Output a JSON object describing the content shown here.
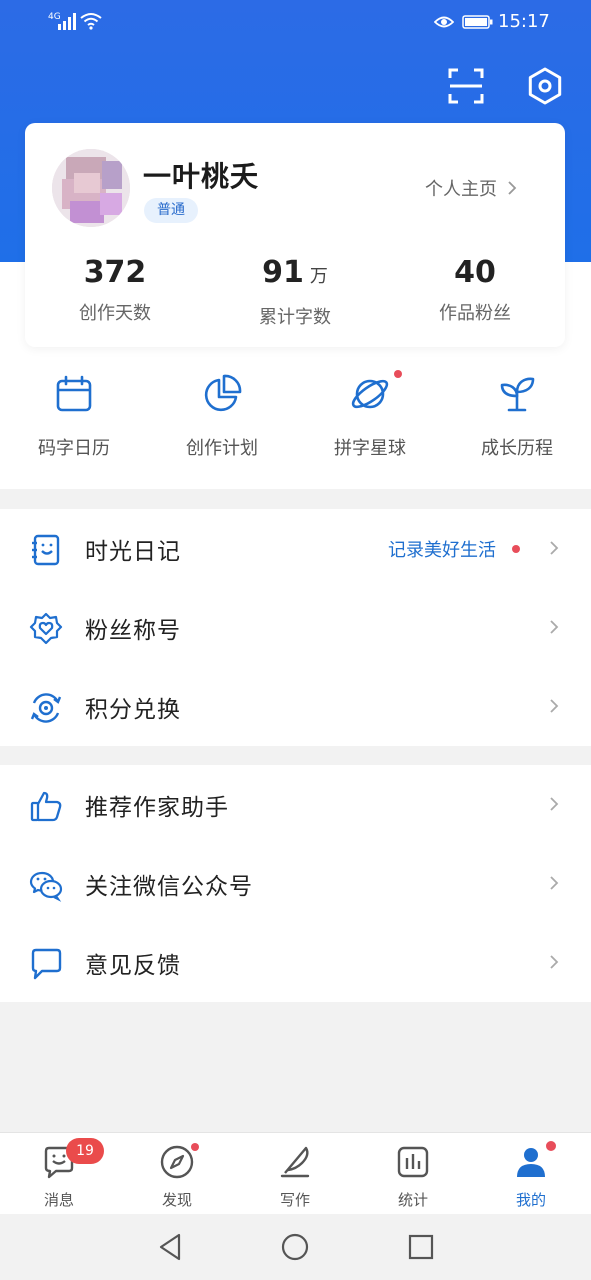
{
  "status_bar": {
    "network": "4G",
    "time": "15:17"
  },
  "profile": {
    "username": "一叶桃夭",
    "level": "普通",
    "homepage_link": "个人主页",
    "stats": [
      {
        "value": "372",
        "unit": "",
        "label": "创作天数"
      },
      {
        "value": "91",
        "unit": "万",
        "label": "累计字数"
      },
      {
        "value": "40",
        "unit": "",
        "label": "作品粉丝"
      }
    ]
  },
  "quick_actions": [
    {
      "label": "码字日历",
      "icon": "calendar-icon"
    },
    {
      "label": "创作计划",
      "icon": "pie-chart-icon"
    },
    {
      "label": "拼字星球",
      "icon": "planet-icon",
      "has_dot": true
    },
    {
      "label": "成长历程",
      "icon": "sprout-icon"
    }
  ],
  "menu_group_1": [
    {
      "label": "时光日记",
      "icon": "diary-icon",
      "hint": "记录美好生活",
      "has_dot": true
    },
    {
      "label": "粉丝称号",
      "icon": "badge-heart-icon"
    },
    {
      "label": "积分兑换",
      "icon": "points-exchange-icon"
    }
  ],
  "menu_group_2": [
    {
      "label": "推荐作家助手",
      "icon": "thumbs-up-icon"
    },
    {
      "label": "关注微信公众号",
      "icon": "wechat-icon"
    },
    {
      "label": "意见反馈",
      "icon": "feedback-icon"
    }
  ],
  "bottom_nav": [
    {
      "label": "消息",
      "icon": "message-icon",
      "badge": "19"
    },
    {
      "label": "发现",
      "icon": "compass-icon",
      "has_dot": true
    },
    {
      "label": "写作",
      "icon": "feather-pen-icon"
    },
    {
      "label": "统计",
      "icon": "bar-chart-icon"
    },
    {
      "label": "我的",
      "icon": "user-icon",
      "has_dot": true,
      "active": true
    }
  ],
  "colors": {
    "header_blue": "#1f6fe8",
    "accent_blue": "#1f6fcf",
    "dot_red": "#e84d5a",
    "badge_red": "#ea4b4b"
  }
}
